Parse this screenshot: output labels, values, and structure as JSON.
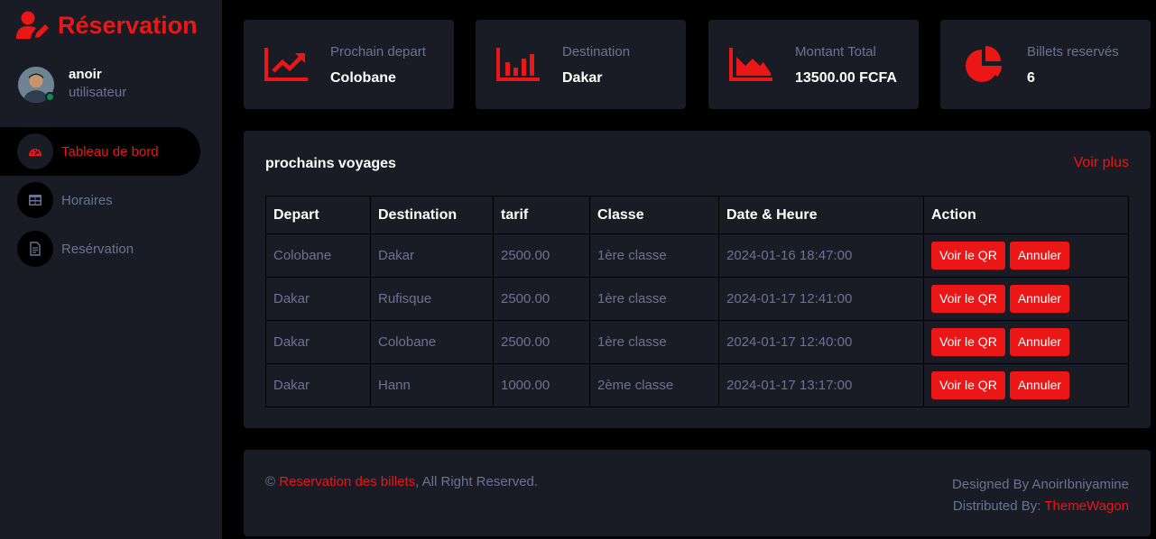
{
  "brand": {
    "title": "Réservation",
    "icon": "user-edit-icon",
    "color": "#eb1616"
  },
  "profile": {
    "name": "anoir",
    "role": "utilisateur",
    "avatar_icon": "user-avatar",
    "status_color": "#198754"
  },
  "nav": [
    {
      "label": "Tableau de bord",
      "icon": "dashboard-icon",
      "active": true
    },
    {
      "label": "Horaires",
      "icon": "table-icon",
      "active": false
    },
    {
      "label": "Resérvation",
      "icon": "document-icon",
      "active": false
    }
  ],
  "cards": [
    {
      "label": "Prochain depart",
      "value": "Colobane",
      "icon": "chart-line-icon"
    },
    {
      "label": "Destination",
      "value": "Dakar",
      "icon": "chart-bar-icon"
    },
    {
      "label": "Montant Total",
      "value": "13500.00 FCFA",
      "icon": "chart-area-icon"
    },
    {
      "label": "Billets reservés",
      "value": "6",
      "icon": "chart-pie-icon"
    }
  ],
  "trips": {
    "title": "prochains voyages",
    "more_label": "Voir plus",
    "headers": [
      "Depart",
      "Destination",
      "tarif",
      "Classe",
      "Date & Heure",
      "Action"
    ],
    "rows": [
      [
        "Colobane",
        "Dakar",
        "2500.00",
        "1ère classe",
        "2024-01-16 18:47:00"
      ],
      [
        "Dakar",
        "Rufisque",
        "2500.00",
        "1ère classe",
        "2024-01-17 12:41:00"
      ],
      [
        "Dakar",
        "Colobane",
        "2500.00",
        "1ère classe",
        "2024-01-17 12:40:00"
      ],
      [
        "Dakar",
        "Hann",
        "1000.00",
        "2ème classe",
        "2024-01-17 13:17:00"
      ]
    ],
    "qr_label": "Voir le QR",
    "cancel_label": "Annuler"
  },
  "footer": {
    "copy_symbol": "©",
    "site_link": "Reservation des billets",
    "rights": ", All Right Reserved.",
    "designed": "Designed By AnoirIbniyamine",
    "distributed_prefix": "Distributed By: ",
    "distributed_link": "ThemeWagon"
  }
}
